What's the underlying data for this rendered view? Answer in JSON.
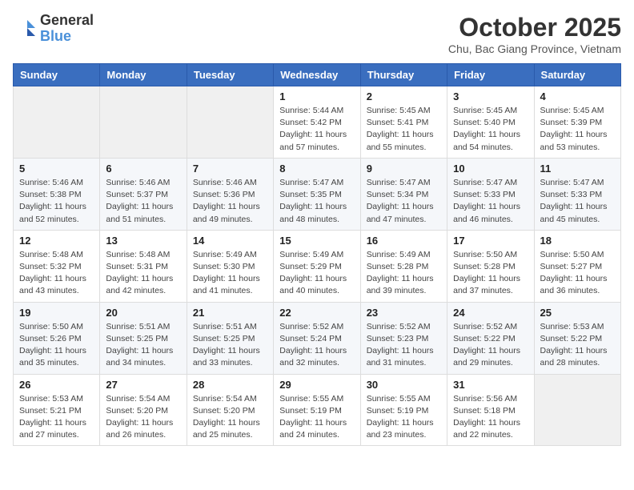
{
  "header": {
    "logo_general": "General",
    "logo_blue": "Blue",
    "month_title": "October 2025",
    "location": "Chu, Bac Giang Province, Vietnam"
  },
  "days_of_week": [
    "Sunday",
    "Monday",
    "Tuesday",
    "Wednesday",
    "Thursday",
    "Friday",
    "Saturday"
  ],
  "weeks": [
    [
      {
        "day": "",
        "info": ""
      },
      {
        "day": "",
        "info": ""
      },
      {
        "day": "",
        "info": ""
      },
      {
        "day": "1",
        "sunrise": "5:44 AM",
        "sunset": "5:42 PM",
        "daylight": "11 hours and 57 minutes."
      },
      {
        "day": "2",
        "sunrise": "5:45 AM",
        "sunset": "5:41 PM",
        "daylight": "11 hours and 55 minutes."
      },
      {
        "day": "3",
        "sunrise": "5:45 AM",
        "sunset": "5:40 PM",
        "daylight": "11 hours and 54 minutes."
      },
      {
        "day": "4",
        "sunrise": "5:45 AM",
        "sunset": "5:39 PM",
        "daylight": "11 hours and 53 minutes."
      }
    ],
    [
      {
        "day": "5",
        "sunrise": "5:46 AM",
        "sunset": "5:38 PM",
        "daylight": "11 hours and 52 minutes."
      },
      {
        "day": "6",
        "sunrise": "5:46 AM",
        "sunset": "5:37 PM",
        "daylight": "11 hours and 51 minutes."
      },
      {
        "day": "7",
        "sunrise": "5:46 AM",
        "sunset": "5:36 PM",
        "daylight": "11 hours and 49 minutes."
      },
      {
        "day": "8",
        "sunrise": "5:47 AM",
        "sunset": "5:35 PM",
        "daylight": "11 hours and 48 minutes."
      },
      {
        "day": "9",
        "sunrise": "5:47 AM",
        "sunset": "5:34 PM",
        "daylight": "11 hours and 47 minutes."
      },
      {
        "day": "10",
        "sunrise": "5:47 AM",
        "sunset": "5:33 PM",
        "daylight": "11 hours and 46 minutes."
      },
      {
        "day": "11",
        "sunrise": "5:47 AM",
        "sunset": "5:33 PM",
        "daylight": "11 hours and 45 minutes."
      }
    ],
    [
      {
        "day": "12",
        "sunrise": "5:48 AM",
        "sunset": "5:32 PM",
        "daylight": "11 hours and 43 minutes."
      },
      {
        "day": "13",
        "sunrise": "5:48 AM",
        "sunset": "5:31 PM",
        "daylight": "11 hours and 42 minutes."
      },
      {
        "day": "14",
        "sunrise": "5:49 AM",
        "sunset": "5:30 PM",
        "daylight": "11 hours and 41 minutes."
      },
      {
        "day": "15",
        "sunrise": "5:49 AM",
        "sunset": "5:29 PM",
        "daylight": "11 hours and 40 minutes."
      },
      {
        "day": "16",
        "sunrise": "5:49 AM",
        "sunset": "5:28 PM",
        "daylight": "11 hours and 39 minutes."
      },
      {
        "day": "17",
        "sunrise": "5:50 AM",
        "sunset": "5:28 PM",
        "daylight": "11 hours and 37 minutes."
      },
      {
        "day": "18",
        "sunrise": "5:50 AM",
        "sunset": "5:27 PM",
        "daylight": "11 hours and 36 minutes."
      }
    ],
    [
      {
        "day": "19",
        "sunrise": "5:50 AM",
        "sunset": "5:26 PM",
        "daylight": "11 hours and 35 minutes."
      },
      {
        "day": "20",
        "sunrise": "5:51 AM",
        "sunset": "5:25 PM",
        "daylight": "11 hours and 34 minutes."
      },
      {
        "day": "21",
        "sunrise": "5:51 AM",
        "sunset": "5:25 PM",
        "daylight": "11 hours and 33 minutes."
      },
      {
        "day": "22",
        "sunrise": "5:52 AM",
        "sunset": "5:24 PM",
        "daylight": "11 hours and 32 minutes."
      },
      {
        "day": "23",
        "sunrise": "5:52 AM",
        "sunset": "5:23 PM",
        "daylight": "11 hours and 31 minutes."
      },
      {
        "day": "24",
        "sunrise": "5:52 AM",
        "sunset": "5:22 PM",
        "daylight": "11 hours and 29 minutes."
      },
      {
        "day": "25",
        "sunrise": "5:53 AM",
        "sunset": "5:22 PM",
        "daylight": "11 hours and 28 minutes."
      }
    ],
    [
      {
        "day": "26",
        "sunrise": "5:53 AM",
        "sunset": "5:21 PM",
        "daylight": "11 hours and 27 minutes."
      },
      {
        "day": "27",
        "sunrise": "5:54 AM",
        "sunset": "5:20 PM",
        "daylight": "11 hours and 26 minutes."
      },
      {
        "day": "28",
        "sunrise": "5:54 AM",
        "sunset": "5:20 PM",
        "daylight": "11 hours and 25 minutes."
      },
      {
        "day": "29",
        "sunrise": "5:55 AM",
        "sunset": "5:19 PM",
        "daylight": "11 hours and 24 minutes."
      },
      {
        "day": "30",
        "sunrise": "5:55 AM",
        "sunset": "5:19 PM",
        "daylight": "11 hours and 23 minutes."
      },
      {
        "day": "31",
        "sunrise": "5:56 AM",
        "sunset": "5:18 PM",
        "daylight": "11 hours and 22 minutes."
      },
      {
        "day": "",
        "info": ""
      }
    ]
  ],
  "labels": {
    "sunrise_prefix": "Sunrise: ",
    "sunset_prefix": "Sunset: ",
    "daylight_label": "Daylight: "
  }
}
